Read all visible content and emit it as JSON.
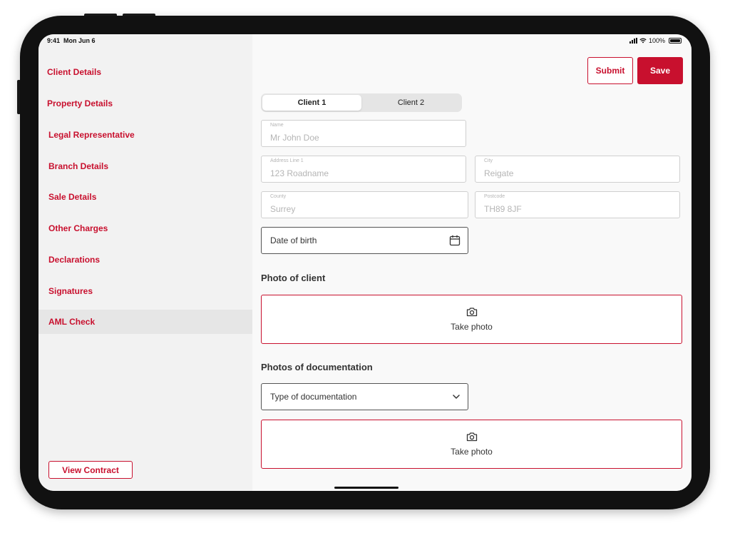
{
  "status_bar": {
    "time": "9:41",
    "date": "Mon Jun 6",
    "battery": "100%"
  },
  "sidebar": {
    "items": [
      {
        "label": "Client Details"
      },
      {
        "label": "Property Details"
      },
      {
        "label": "Legal Representative"
      },
      {
        "label": "Branch Details"
      },
      {
        "label": "Sale Details"
      },
      {
        "label": "Other Charges"
      },
      {
        "label": "Declarations"
      },
      {
        "label": "Signatures"
      },
      {
        "label": "AML Check",
        "active": true
      }
    ],
    "view_contract_label": "View Contract"
  },
  "header": {
    "submit_label": "Submit",
    "save_label": "Save"
  },
  "client_tabs": [
    {
      "label": "Client 1",
      "active": true
    },
    {
      "label": "Client 2",
      "active": false
    }
  ],
  "form": {
    "name": {
      "label": "Name",
      "placeholder": "Mr John Doe"
    },
    "address_line_1": {
      "label": "Address Line 1",
      "placeholder": "123 Roadname"
    },
    "city": {
      "label": "City",
      "placeholder": "Reigate"
    },
    "county": {
      "label": "County",
      "placeholder": "Surrey"
    },
    "postcode": {
      "label": "Postcode",
      "placeholder": "TH89 8JF"
    },
    "date_of_birth": {
      "placeholder": "Date of birth"
    }
  },
  "photo_of_client": {
    "title": "Photo of client",
    "action": "Take photo"
  },
  "photos_of_documentation": {
    "title": "Photos of documentation",
    "select_value": "Type of documentation",
    "action": "Take photo"
  },
  "colors": {
    "accent": "#c8102e",
    "sidebar_bg": "#f2f2f2",
    "content_bg": "#f9f9f9"
  },
  "icons": [
    "signal-icon",
    "wifi-icon",
    "battery-icon",
    "calendar-icon",
    "camera-icon",
    "chevron-down-icon"
  ]
}
